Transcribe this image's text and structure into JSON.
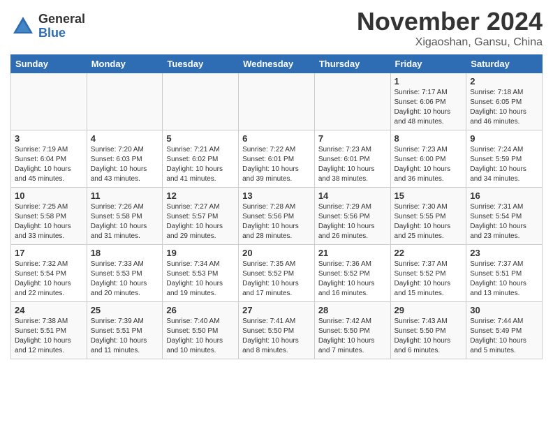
{
  "logo": {
    "general": "General",
    "blue": "Blue"
  },
  "title": "November 2024",
  "location": "Xigaoshan, Gansu, China",
  "weekdays": [
    "Sunday",
    "Monday",
    "Tuesday",
    "Wednesday",
    "Thursday",
    "Friday",
    "Saturday"
  ],
  "weeks": [
    [
      {
        "day": "",
        "info": ""
      },
      {
        "day": "",
        "info": ""
      },
      {
        "day": "",
        "info": ""
      },
      {
        "day": "",
        "info": ""
      },
      {
        "day": "",
        "info": ""
      },
      {
        "day": "1",
        "info": "Sunrise: 7:17 AM\nSunset: 6:06 PM\nDaylight: 10 hours\nand 48 minutes."
      },
      {
        "day": "2",
        "info": "Sunrise: 7:18 AM\nSunset: 6:05 PM\nDaylight: 10 hours\nand 46 minutes."
      }
    ],
    [
      {
        "day": "3",
        "info": "Sunrise: 7:19 AM\nSunset: 6:04 PM\nDaylight: 10 hours\nand 45 minutes."
      },
      {
        "day": "4",
        "info": "Sunrise: 7:20 AM\nSunset: 6:03 PM\nDaylight: 10 hours\nand 43 minutes."
      },
      {
        "day": "5",
        "info": "Sunrise: 7:21 AM\nSunset: 6:02 PM\nDaylight: 10 hours\nand 41 minutes."
      },
      {
        "day": "6",
        "info": "Sunrise: 7:22 AM\nSunset: 6:01 PM\nDaylight: 10 hours\nand 39 minutes."
      },
      {
        "day": "7",
        "info": "Sunrise: 7:23 AM\nSunset: 6:01 PM\nDaylight: 10 hours\nand 38 minutes."
      },
      {
        "day": "8",
        "info": "Sunrise: 7:23 AM\nSunset: 6:00 PM\nDaylight: 10 hours\nand 36 minutes."
      },
      {
        "day": "9",
        "info": "Sunrise: 7:24 AM\nSunset: 5:59 PM\nDaylight: 10 hours\nand 34 minutes."
      }
    ],
    [
      {
        "day": "10",
        "info": "Sunrise: 7:25 AM\nSunset: 5:58 PM\nDaylight: 10 hours\nand 33 minutes."
      },
      {
        "day": "11",
        "info": "Sunrise: 7:26 AM\nSunset: 5:58 PM\nDaylight: 10 hours\nand 31 minutes."
      },
      {
        "day": "12",
        "info": "Sunrise: 7:27 AM\nSunset: 5:57 PM\nDaylight: 10 hours\nand 29 minutes."
      },
      {
        "day": "13",
        "info": "Sunrise: 7:28 AM\nSunset: 5:56 PM\nDaylight: 10 hours\nand 28 minutes."
      },
      {
        "day": "14",
        "info": "Sunrise: 7:29 AM\nSunset: 5:56 PM\nDaylight: 10 hours\nand 26 minutes."
      },
      {
        "day": "15",
        "info": "Sunrise: 7:30 AM\nSunset: 5:55 PM\nDaylight: 10 hours\nand 25 minutes."
      },
      {
        "day": "16",
        "info": "Sunrise: 7:31 AM\nSunset: 5:54 PM\nDaylight: 10 hours\nand 23 minutes."
      }
    ],
    [
      {
        "day": "17",
        "info": "Sunrise: 7:32 AM\nSunset: 5:54 PM\nDaylight: 10 hours\nand 22 minutes."
      },
      {
        "day": "18",
        "info": "Sunrise: 7:33 AM\nSunset: 5:53 PM\nDaylight: 10 hours\nand 20 minutes."
      },
      {
        "day": "19",
        "info": "Sunrise: 7:34 AM\nSunset: 5:53 PM\nDaylight: 10 hours\nand 19 minutes."
      },
      {
        "day": "20",
        "info": "Sunrise: 7:35 AM\nSunset: 5:52 PM\nDaylight: 10 hours\nand 17 minutes."
      },
      {
        "day": "21",
        "info": "Sunrise: 7:36 AM\nSunset: 5:52 PM\nDaylight: 10 hours\nand 16 minutes."
      },
      {
        "day": "22",
        "info": "Sunrise: 7:37 AM\nSunset: 5:52 PM\nDaylight: 10 hours\nand 15 minutes."
      },
      {
        "day": "23",
        "info": "Sunrise: 7:37 AM\nSunset: 5:51 PM\nDaylight: 10 hours\nand 13 minutes."
      }
    ],
    [
      {
        "day": "24",
        "info": "Sunrise: 7:38 AM\nSunset: 5:51 PM\nDaylight: 10 hours\nand 12 minutes."
      },
      {
        "day": "25",
        "info": "Sunrise: 7:39 AM\nSunset: 5:51 PM\nDaylight: 10 hours\nand 11 minutes."
      },
      {
        "day": "26",
        "info": "Sunrise: 7:40 AM\nSunset: 5:50 PM\nDaylight: 10 hours\nand 10 minutes."
      },
      {
        "day": "27",
        "info": "Sunrise: 7:41 AM\nSunset: 5:50 PM\nDaylight: 10 hours\nand 8 minutes."
      },
      {
        "day": "28",
        "info": "Sunrise: 7:42 AM\nSunset: 5:50 PM\nDaylight: 10 hours\nand 7 minutes."
      },
      {
        "day": "29",
        "info": "Sunrise: 7:43 AM\nSunset: 5:50 PM\nDaylight: 10 hours\nand 6 minutes."
      },
      {
        "day": "30",
        "info": "Sunrise: 7:44 AM\nSunset: 5:49 PM\nDaylight: 10 hours\nand 5 minutes."
      }
    ]
  ]
}
